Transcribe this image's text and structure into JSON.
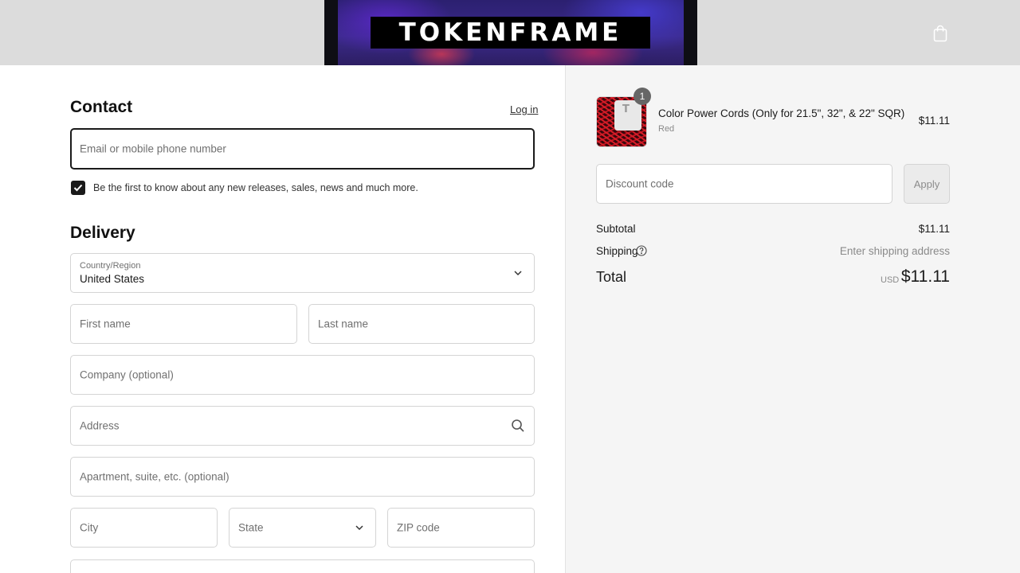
{
  "header": {
    "logo_text": "TOKENFRAME",
    "cart_icon": "shopping-bag-icon"
  },
  "contact": {
    "heading": "Contact",
    "login_label": "Log in",
    "email_placeholder": "Email or mobile phone number",
    "newsletter_checked": true,
    "newsletter_label": "Be the first to know about any new releases, sales, news and much more."
  },
  "delivery": {
    "heading": "Delivery",
    "country_label": "Country/Region",
    "country_value": "United States",
    "first_name_placeholder": "First name",
    "last_name_placeholder": "Last name",
    "company_placeholder": "Company (optional)",
    "address_placeholder": "Address",
    "apartment_placeholder": "Apartment, suite, etc. (optional)",
    "city_placeholder": "City",
    "state_placeholder": "State",
    "zip_placeholder": "ZIP code"
  },
  "summary": {
    "item": {
      "quantity": "1",
      "title": "Color Power Cords (Only for 21.5\", 32\", & 22\" SQR)",
      "variant": "Red",
      "price": "$11.11"
    },
    "discount_placeholder": "Discount code",
    "apply_label": "Apply",
    "subtotal_label": "Subtotal",
    "subtotal_value": "$11.11",
    "shipping_label": "Shipping",
    "shipping_value": "Enter shipping address",
    "total_label": "Total",
    "total_currency": "USD",
    "total_value": "$11.11"
  },
  "colors": {
    "accent": "#1a1a1a",
    "header_bg": "#dcdcdc",
    "summary_bg": "#f5f5f5"
  }
}
